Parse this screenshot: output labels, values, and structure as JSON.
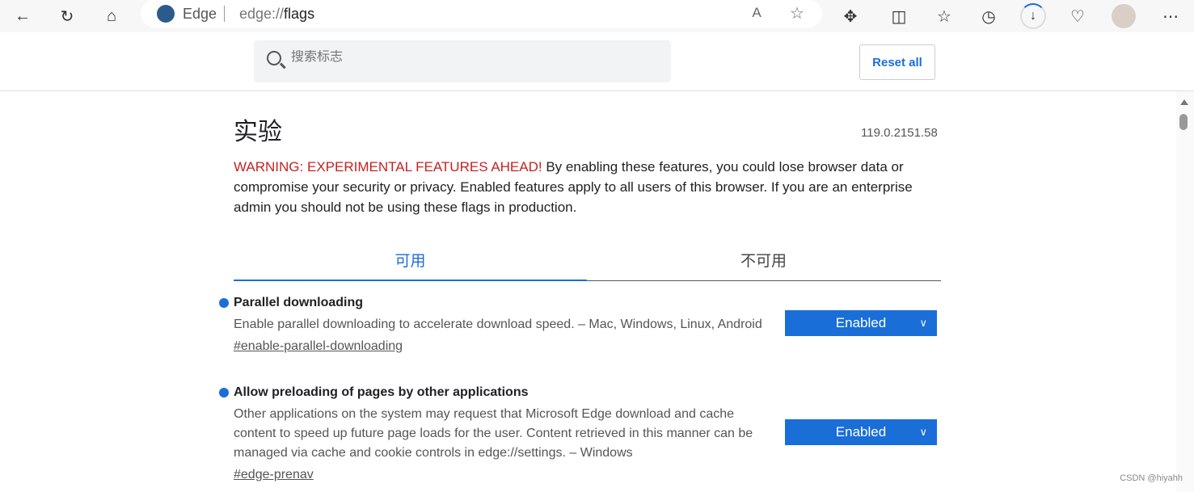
{
  "browser": {
    "address_brand": "Edge",
    "url_prefix": "edge://",
    "url_main": "flags"
  },
  "header": {
    "search_placeholder": "搜索标志",
    "reset_label": "Reset all"
  },
  "main": {
    "title": "实验",
    "version": "119.0.2151.58",
    "warning_red": "WARNING: EXPERIMENTAL FEATURES AHEAD!",
    "warning_text": " By enabling these features, you could lose browser data or compromise your security or privacy. Enabled features apply to all users of this browser. If you are an enterprise admin you should not be using these flags in production.",
    "tabs": [
      {
        "label": "可用",
        "active": true
      },
      {
        "label": "不可用",
        "active": false
      }
    ],
    "flags": [
      {
        "title": "Parallel downloading",
        "description": "Enable parallel downloading to accelerate download speed. – Mac, Windows, Linux, Android",
        "link": "#enable-parallel-downloading",
        "value": "Enabled"
      },
      {
        "title": "Allow preloading of pages by other applications",
        "description": "Other applications on the system may request that Microsoft Edge download and cache content to speed up future page loads for the user. Content retrieved in this manner can be managed via cache and cookie controls in edge://settings. – Windows",
        "link": "#edge-prenav",
        "value": "Enabled"
      }
    ]
  },
  "watermark": "CSDN @hiyahh",
  "colors": {
    "accent": "#1a6ed8",
    "warning": "#c5221f"
  }
}
